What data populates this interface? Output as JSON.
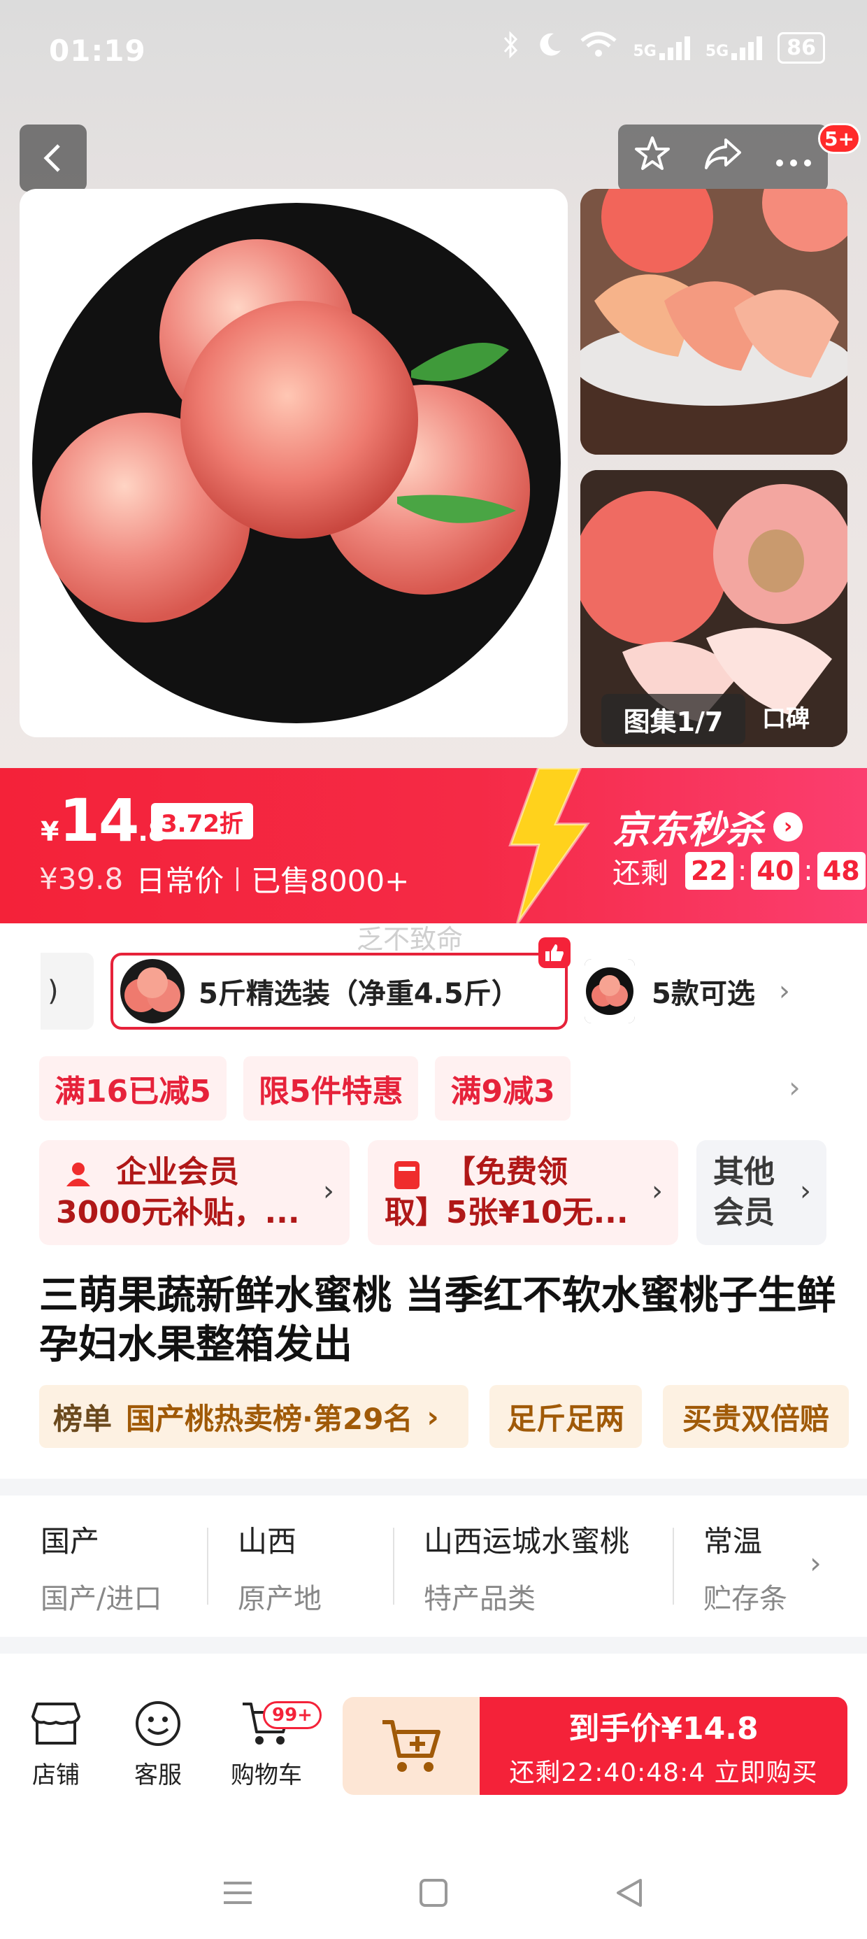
{
  "status_bar": {
    "time": "01:19",
    "network1": "5G",
    "network2": "5G",
    "battery": "86"
  },
  "header": {
    "back_icon": "chevron-left-icon",
    "notification_badge": "5+"
  },
  "gallery": {
    "label": "图集1/7",
    "koubei": "口碑"
  },
  "price_banner": {
    "currency": "¥",
    "price_int": "14",
    "price_dec": ".8",
    "discount": "3.72折",
    "original_price": "¥39.8",
    "original_label": "日常价",
    "sold": "已售8000+",
    "brand_title": "京东秒杀",
    "countdown_label": "还剩",
    "hh": "22",
    "mm": "40",
    "ss": "48"
  },
  "watermark": "乏不致命",
  "specs": {
    "partial": ")",
    "selected": "5斤精选装（净重4.5斤）",
    "more": "5款可选"
  },
  "promos": [
    "满16已减5",
    "限5件特惠",
    "满9减3"
  ],
  "members": {
    "card1": [
      "企业会员",
      "3000元补贴，..."
    ],
    "card2": [
      "【免费领",
      "取】5张¥10无..."
    ],
    "card3": [
      "其他",
      "会员"
    ]
  },
  "product": {
    "title": "三萌果蔬新鲜水蜜桃 当季红不软水蜜桃子生鲜孕妇水果整箱发出"
  },
  "tags": {
    "rank_label": "榜单",
    "rank_text": "国产桃热卖榜·第29名",
    "tag2": "足斤足两",
    "tag3": "买贵双倍赔"
  },
  "params": [
    {
      "value": "国产",
      "key": "国产/进口"
    },
    {
      "value": "山西",
      "key": "原产地"
    },
    {
      "value": "山西运城水蜜桃",
      "key": "特产品类"
    },
    {
      "value": "常温",
      "key": "贮存条"
    }
  ],
  "bottom_bar": {
    "shop": "店铺",
    "service": "客服",
    "cart": "购物车",
    "cart_badge": "99+",
    "buy_line1": "到手价¥14.8",
    "buy_line2": "还剩22:40:48:4 立即购买"
  },
  "colors": {
    "accent_red": "#f42239",
    "promo_bg": "#fff1f1",
    "tag_bg": "#fdf1e2"
  }
}
